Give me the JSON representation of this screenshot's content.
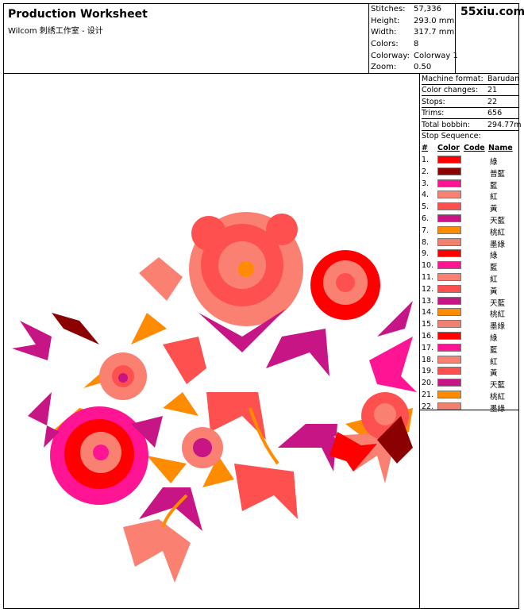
{
  "header": {
    "title": "Production Worksheet",
    "subtitle": "Wilcom 刺绣工作室 - 设计",
    "brand": "55xiu.com"
  },
  "stats": [
    {
      "label": "Stitches:",
      "value": "57,336"
    },
    {
      "label": "Height:",
      "value": "293.0 mm"
    },
    {
      "label": "Width:",
      "value": "317.7 mm"
    },
    {
      "label": "Colors:",
      "value": "8"
    },
    {
      "label": "Colorway:",
      "value": "Colorway 1"
    },
    {
      "label": "Zoom:",
      "value": "0.50"
    }
  ],
  "machine": [
    {
      "label": "Machine format:",
      "value": "Barudan"
    },
    {
      "label": "Color changes:",
      "value": "21"
    },
    {
      "label": "Stops:",
      "value": "22"
    },
    {
      "label": "Trims:",
      "value": "656"
    },
    {
      "label": "Total bobbin:",
      "value": "294.77m"
    }
  ],
  "sequence": {
    "title": "Stop Sequence:",
    "headers": {
      "num": "#",
      "color": "Color",
      "code": "Code",
      "name": "Name"
    },
    "rows": [
      {
        "num": "1.",
        "color": "#ff0000",
        "name": "綠"
      },
      {
        "num": "2.",
        "color": "#8b0000",
        "name": "普藍"
      },
      {
        "num": "3.",
        "color": "#ff1493",
        "name": "藍"
      },
      {
        "num": "4.",
        "color": "#fa8072",
        "name": "紅"
      },
      {
        "num": "5.",
        "color": "#ff5050",
        "name": "黃"
      },
      {
        "num": "6.",
        "color": "#c71585",
        "name": "天藍"
      },
      {
        "num": "7.",
        "color": "#ff8c00",
        "name": "桃紅"
      },
      {
        "num": "8.",
        "color": "#f08070",
        "name": "墨綠"
      },
      {
        "num": "9.",
        "color": "#ff0000",
        "name": "綠"
      },
      {
        "num": "10.",
        "color": "#ff1493",
        "name": "藍"
      },
      {
        "num": "11.",
        "color": "#fa8072",
        "name": "紅"
      },
      {
        "num": "12.",
        "color": "#ff5050",
        "name": "黃"
      },
      {
        "num": "13.",
        "color": "#c71585",
        "name": "天藍"
      },
      {
        "num": "14.",
        "color": "#ff8c00",
        "name": "桃紅"
      },
      {
        "num": "15.",
        "color": "#f08070",
        "name": "墨綠"
      },
      {
        "num": "16.",
        "color": "#ff0000",
        "name": "綠"
      },
      {
        "num": "17.",
        "color": "#ff1493",
        "name": "藍"
      },
      {
        "num": "18.",
        "color": "#fa8072",
        "name": "紅"
      },
      {
        "num": "19.",
        "color": "#ff5050",
        "name": "黃"
      },
      {
        "num": "20.",
        "color": "#c71585",
        "name": "天藍"
      },
      {
        "num": "21.",
        "color": "#ff8c00",
        "name": "桃紅"
      },
      {
        "num": "22.",
        "color": "#f08070",
        "name": "墨綠"
      }
    ]
  }
}
